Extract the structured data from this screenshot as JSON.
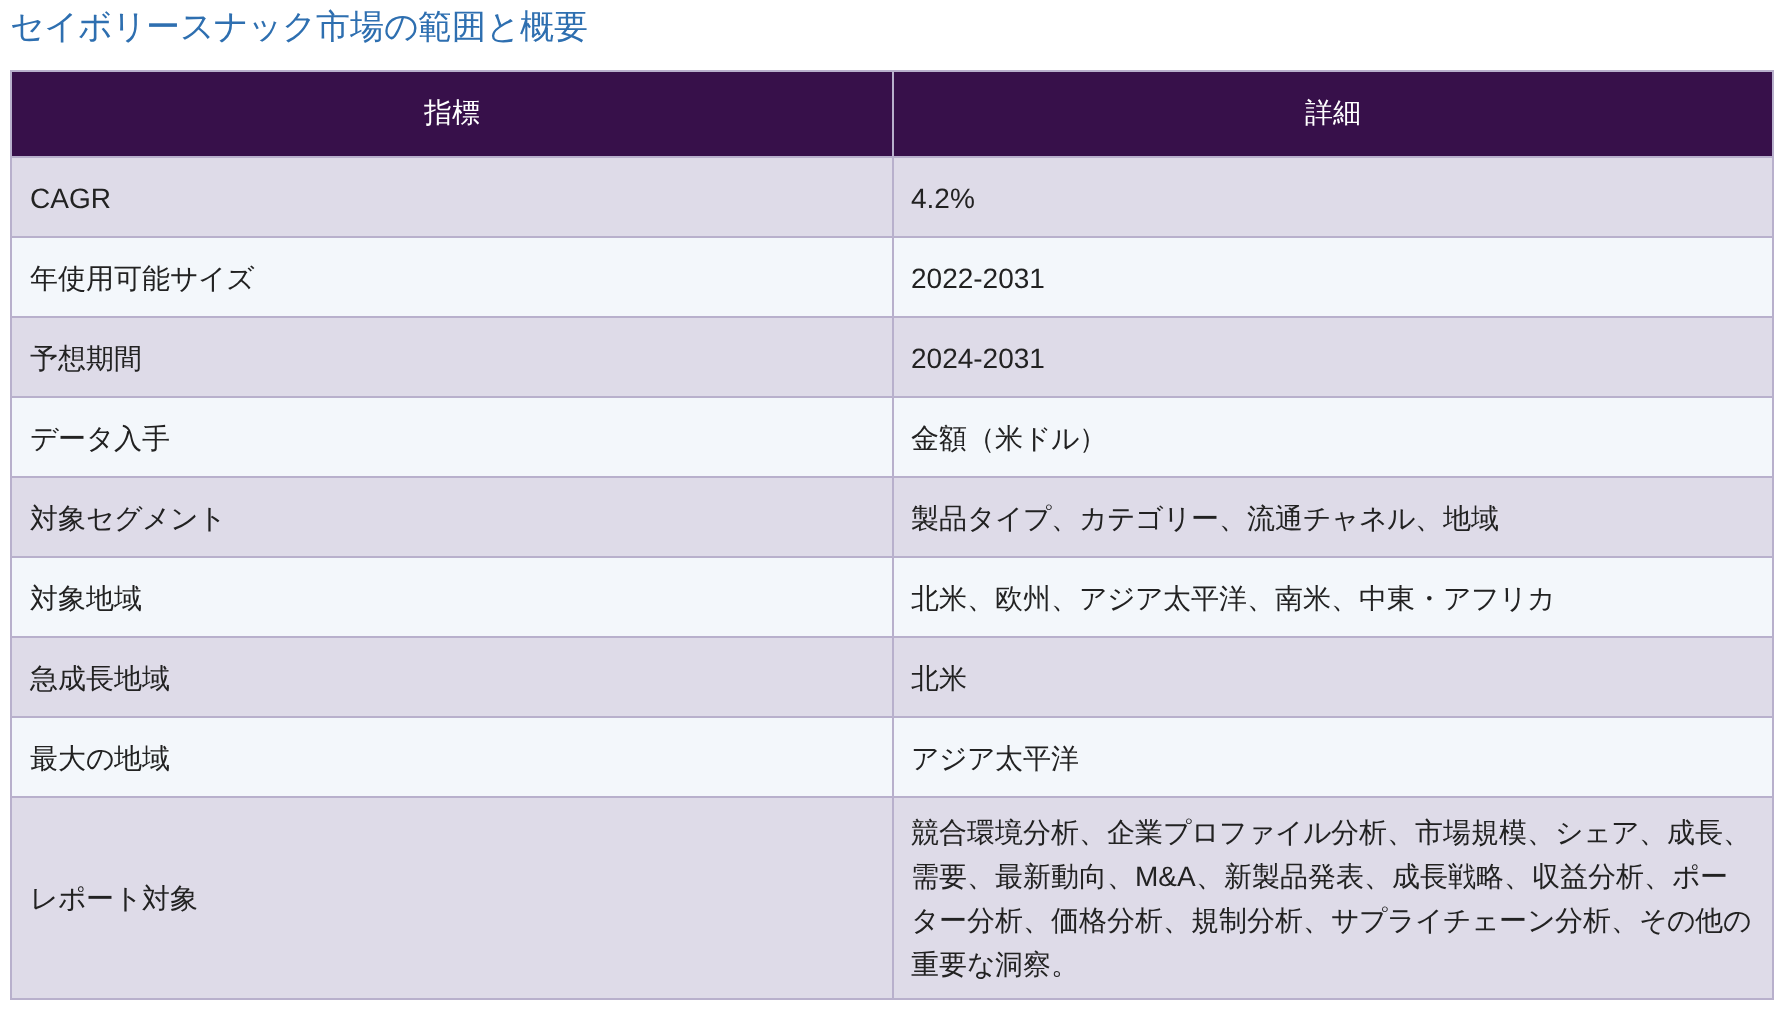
{
  "title": "セイボリースナック市場の範囲と概要",
  "table": {
    "columns": [
      "指標",
      "詳細"
    ],
    "rows": [
      [
        "CAGR",
        "4.2%"
      ],
      [
        "年使用可能サイズ",
        "2022-2031"
      ],
      [
        "予想期間",
        "2024-2031"
      ],
      [
        "データ入手",
        "金額（米ドル）"
      ],
      [
        "対象セグメント",
        "製品タイプ、カテゴリー、流通チャネル、地域"
      ],
      [
        "対象地域",
        "北米、欧州、アジア太平洋、南米、中東・アフリカ"
      ],
      [
        "急成長地域",
        "北米"
      ],
      [
        "最大の地域",
        "アジア太平洋"
      ],
      [
        "レポート対象",
        "競合環境分析、企業プロファイル分析、市場規模、シェア、成長、需要、最新動向、M&A、新製品発表、成長戦略、収益分析、ポーター分析、価格分析、規制分析、サプライチェーン分析、その他の重要な洞察。"
      ]
    ]
  }
}
